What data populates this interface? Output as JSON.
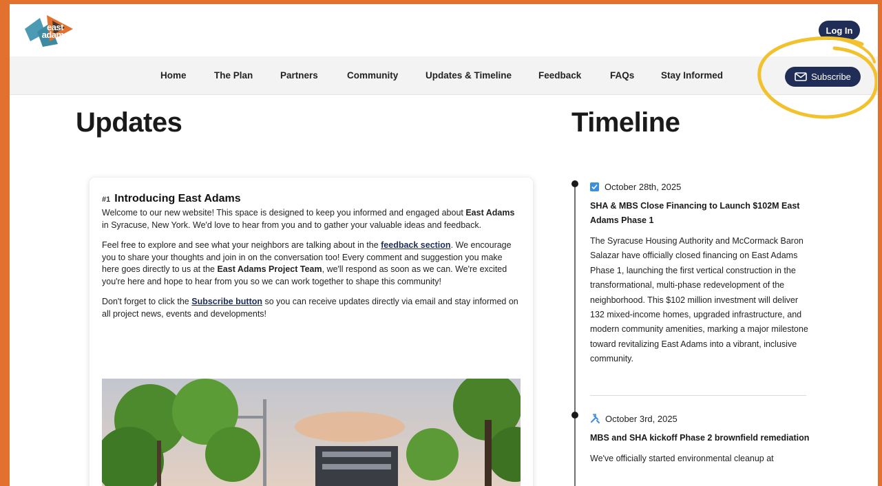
{
  "header": {
    "logo_text_line1": "east",
    "logo_text_line2": "adams",
    "login_label": "Log In"
  },
  "nav": {
    "items": [
      {
        "label": "Home"
      },
      {
        "label": "The Plan"
      },
      {
        "label": "Partners"
      },
      {
        "label": "Community"
      },
      {
        "label": "Updates & Timeline"
      },
      {
        "label": "Feedback"
      },
      {
        "label": "FAQs"
      },
      {
        "label": "Stay Informed"
      }
    ],
    "subscribe_label": "Subscribe"
  },
  "updates": {
    "title": "Updates",
    "post": {
      "number": "#1",
      "title": "Introducing East Adams",
      "p1_a": "Welcome to our new website! This space is designed to keep you informed and engaged about ",
      "p1_b": "East Adams",
      "p1_c": " in Syracuse, New York. We'd love to hear from you and to gather your valuable ideas and feedback.",
      "p2_a": "Feel free to explore and see what your neighbors are talking about in the ",
      "p2_link": "feedback section",
      "p2_b": ". We encourage you to share your thoughts and join in on the conversation too! Every comment and suggestion you make here goes directly to us at the ",
      "p2_bold": "East Adams Project Team",
      "p2_c": ", we'll respond as soon as we can. We're excited you're here and hope to hear from you so we can work together to shape this community!",
      "p3_a": "Don't forget to click the ",
      "p3_link": "Subscribe button",
      "p3_b": " so you can receive updates directly via email and stay informed on all project news, events and developments!"
    }
  },
  "timeline": {
    "title": "Timeline",
    "entries": [
      {
        "date": "October 28th, 2025",
        "icon": "check-icon",
        "heading": "SHA & MBS Close Financing to Launch $102M East Adams Phase 1",
        "text": "The Syracuse Housing Authority and McCormack Baron Salazar have officially closed financing on East Adams Phase 1, launching the first vertical construction in the transformational, multi-phase redevelopment of the neighborhood. This $102 million investment will deliver 132 mixed-income homes, upgraded infrastructure, and modern community amenities, marking a major milestone toward revitalizing East Adams into a vibrant, inclusive community."
      },
      {
        "date": "October 3rd, 2025",
        "icon": "tools-icon",
        "heading": "MBS and SHA kickoff Phase 2 brownfield remediation",
        "text": "We've officially started environmental cleanup at"
      }
    ]
  },
  "colors": {
    "frame": "#e2702e",
    "navy": "#1f2d57",
    "highlight": "#f2c12e",
    "check_blue": "#3b8fe0"
  }
}
